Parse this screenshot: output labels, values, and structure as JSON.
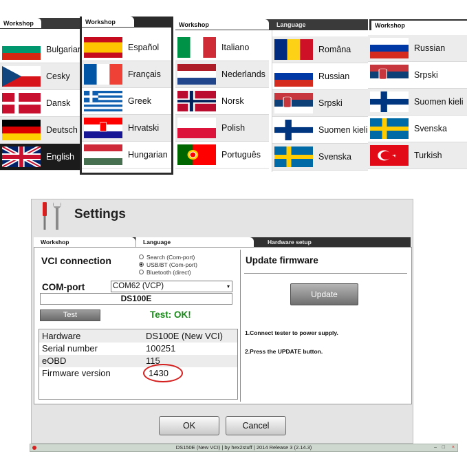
{
  "language_panels": [
    {
      "tabs": [
        {
          "label": "Workshop"
        }
      ],
      "languages": [
        {
          "label": "Bulgarian",
          "flag": "bulgaria-flag"
        },
        {
          "label": "Cesky",
          "flag": "czech-flag"
        },
        {
          "label": "Dansk",
          "flag": "denmark-flag"
        },
        {
          "label": "Deutsch",
          "flag": "germany-flag"
        },
        {
          "label": "English",
          "flag": "uk-flag",
          "selected": true
        }
      ]
    },
    {
      "tabs": [
        {
          "label": "Workshop"
        }
      ],
      "languages": [
        {
          "label": "Español",
          "flag": "spain-flag"
        },
        {
          "label": "Français",
          "flag": "france-flag"
        },
        {
          "label": "Greek",
          "flag": "greece-flag"
        },
        {
          "label": "Hrvatski",
          "flag": "croatia-flag"
        },
        {
          "label": "Hungarian",
          "flag": "hungary-flag"
        }
      ]
    },
    {
      "tabs": [
        {
          "label": "Workshop"
        },
        {
          "label": "Language"
        }
      ],
      "languages": [
        {
          "label": "Italiano",
          "flag": "italy-flag"
        },
        {
          "label": "Nederlands",
          "flag": "netherlands-flag"
        },
        {
          "label": "Norsk",
          "flag": "norway-flag"
        },
        {
          "label": "Polish",
          "flag": "poland-flag"
        },
        {
          "label": "Português",
          "flag": "portugal-flag"
        }
      ],
      "languages_col2": [
        {
          "label": "Româna",
          "flag": "romania-flag"
        },
        {
          "label": "Russian",
          "flag": "russia-flag"
        },
        {
          "label": "Srpski",
          "flag": "serbia-flag"
        },
        {
          "label": "Suomen kieli",
          "flag": "finland-flag"
        },
        {
          "label": "Svenska",
          "flag": "sweden-flag"
        }
      ]
    },
    {
      "tabs": [
        {
          "label": "Workshop"
        }
      ],
      "languages": [
        {
          "label": "Russian",
          "flag": "russia-flag"
        },
        {
          "label": "Srpski",
          "flag": "serbia-flag"
        },
        {
          "label": "Suomen kieli",
          "flag": "finland-flag"
        },
        {
          "label": "Svenska",
          "flag": "sweden-flag"
        },
        {
          "label": "Turkish",
          "flag": "turkey-flag"
        }
      ]
    }
  ],
  "settings": {
    "title": "Settings",
    "icon": "tools-icon",
    "tabs": [
      "Workshop",
      "Language",
      "Hardware setup"
    ],
    "active_tab": "Hardware setup",
    "vci": {
      "title": "VCI connection",
      "options": [
        {
          "label": "Search (Com-port)",
          "selected": false
        },
        {
          "label": "USB/BT (Com-port)",
          "selected": true
        },
        {
          "label": "Bluetooth (direct)",
          "selected": false
        }
      ],
      "com_port_label": "COM-port",
      "com_port_value": "COM62 (VCP)",
      "device": "DS100E",
      "test_button": "Test",
      "test_result": "Test: OK!",
      "test_result_color": "#1a8a1a",
      "info": [
        {
          "key": "Hardware",
          "value": "DS100E (New VCI)"
        },
        {
          "key": "Serial number",
          "value": "100251"
        },
        {
          "key": "eOBD",
          "value": "115"
        },
        {
          "key": "Firmware version",
          "value": "1430"
        }
      ],
      "highlight_color": "#d41f1f"
    },
    "firmware": {
      "title": "Update firmware",
      "update_button": "Update",
      "instructions": [
        "1.Connect tester to power supply.",
        "2.Press the UPDATE button."
      ]
    },
    "ok_button": "OK",
    "cancel_button": "Cancel"
  },
  "status_bar": {
    "text": "DS150E (New VCI) | by hex2stuff | 2014 Release 3 (2.14.3)",
    "minimize": "–",
    "maximize": "□",
    "close": "×"
  }
}
